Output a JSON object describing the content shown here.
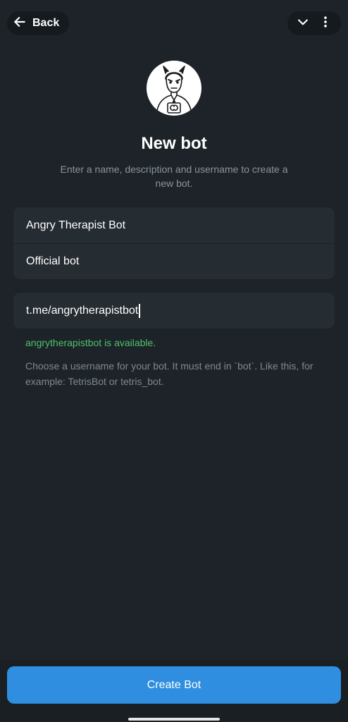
{
  "header": {
    "back_label": "Back",
    "icons": [
      "arrow-left-icon",
      "chevron-down-icon",
      "more-vertical-icon"
    ]
  },
  "title": "New bot",
  "subtitle": "Enter a name, description and username to create a new bot.",
  "form": {
    "name_value": "Angry Therapist Bot",
    "description_value": "Official bot",
    "username_value": "t.me/angrytherapistbot"
  },
  "status": {
    "available_text": "angrytherapistbot is available."
  },
  "hint": "Choose a username for your bot. It must end in `bot`. Like this, for example: TetrisBot or tetris_bot.",
  "footer": {
    "create_label": "Create Bot"
  },
  "colors": {
    "background": "#1d2328",
    "card": "#252c32",
    "accent": "#2f8ee0",
    "success": "#4cc26b"
  }
}
